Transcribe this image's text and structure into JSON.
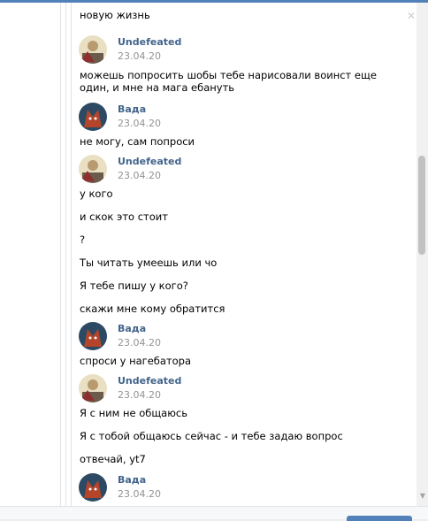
{
  "messages": [
    {
      "type": "text",
      "text": "новую жизнь"
    },
    {
      "type": "header",
      "author": "Undefeated",
      "date": "23.04.20",
      "avatar": "undefeated-avatar"
    },
    {
      "type": "text",
      "text": "можешь попросить шобы тебе нарисовали воинст еще один, и мне на мага ебануть"
    },
    {
      "type": "header",
      "author": "Вада",
      "date": "23.04.20",
      "avatar": "vada-avatar"
    },
    {
      "type": "text",
      "text": "не могу, сам попроси"
    },
    {
      "type": "header",
      "author": "Undefeated",
      "date": "23.04.20",
      "avatar": "undefeated-avatar"
    },
    {
      "type": "text",
      "text": "у кого"
    },
    {
      "type": "text",
      "text": "и скок это стоит"
    },
    {
      "type": "text",
      "text": "?"
    },
    {
      "type": "text",
      "text": "Ты читать умеешь или чо"
    },
    {
      "type": "text",
      "text": "Я тебе пишу у кого?"
    },
    {
      "type": "text",
      "text": "скажи мне кому обратится"
    },
    {
      "type": "header",
      "author": "Вада",
      "date": "23.04.20",
      "avatar": "vada-avatar"
    },
    {
      "type": "text",
      "text": "спроси у нагебатора"
    },
    {
      "type": "header",
      "author": "Undefeated",
      "date": "23.04.20",
      "avatar": "undefeated-avatar"
    },
    {
      "type": "text",
      "text": "Я с ним не общаюсь"
    },
    {
      "type": "text",
      "text": "Я с тобой общаюсь сейчас - и тебе задаю вопрос"
    },
    {
      "type": "text",
      "text": "отвечай, yt7"
    },
    {
      "type": "header",
      "author": "Вада",
      "date": "23.04.20",
      "avatar": "vada-avatar"
    }
  ],
  "colors": {
    "author": "#42648b",
    "date": "#939393",
    "accent": "#5181b8"
  }
}
